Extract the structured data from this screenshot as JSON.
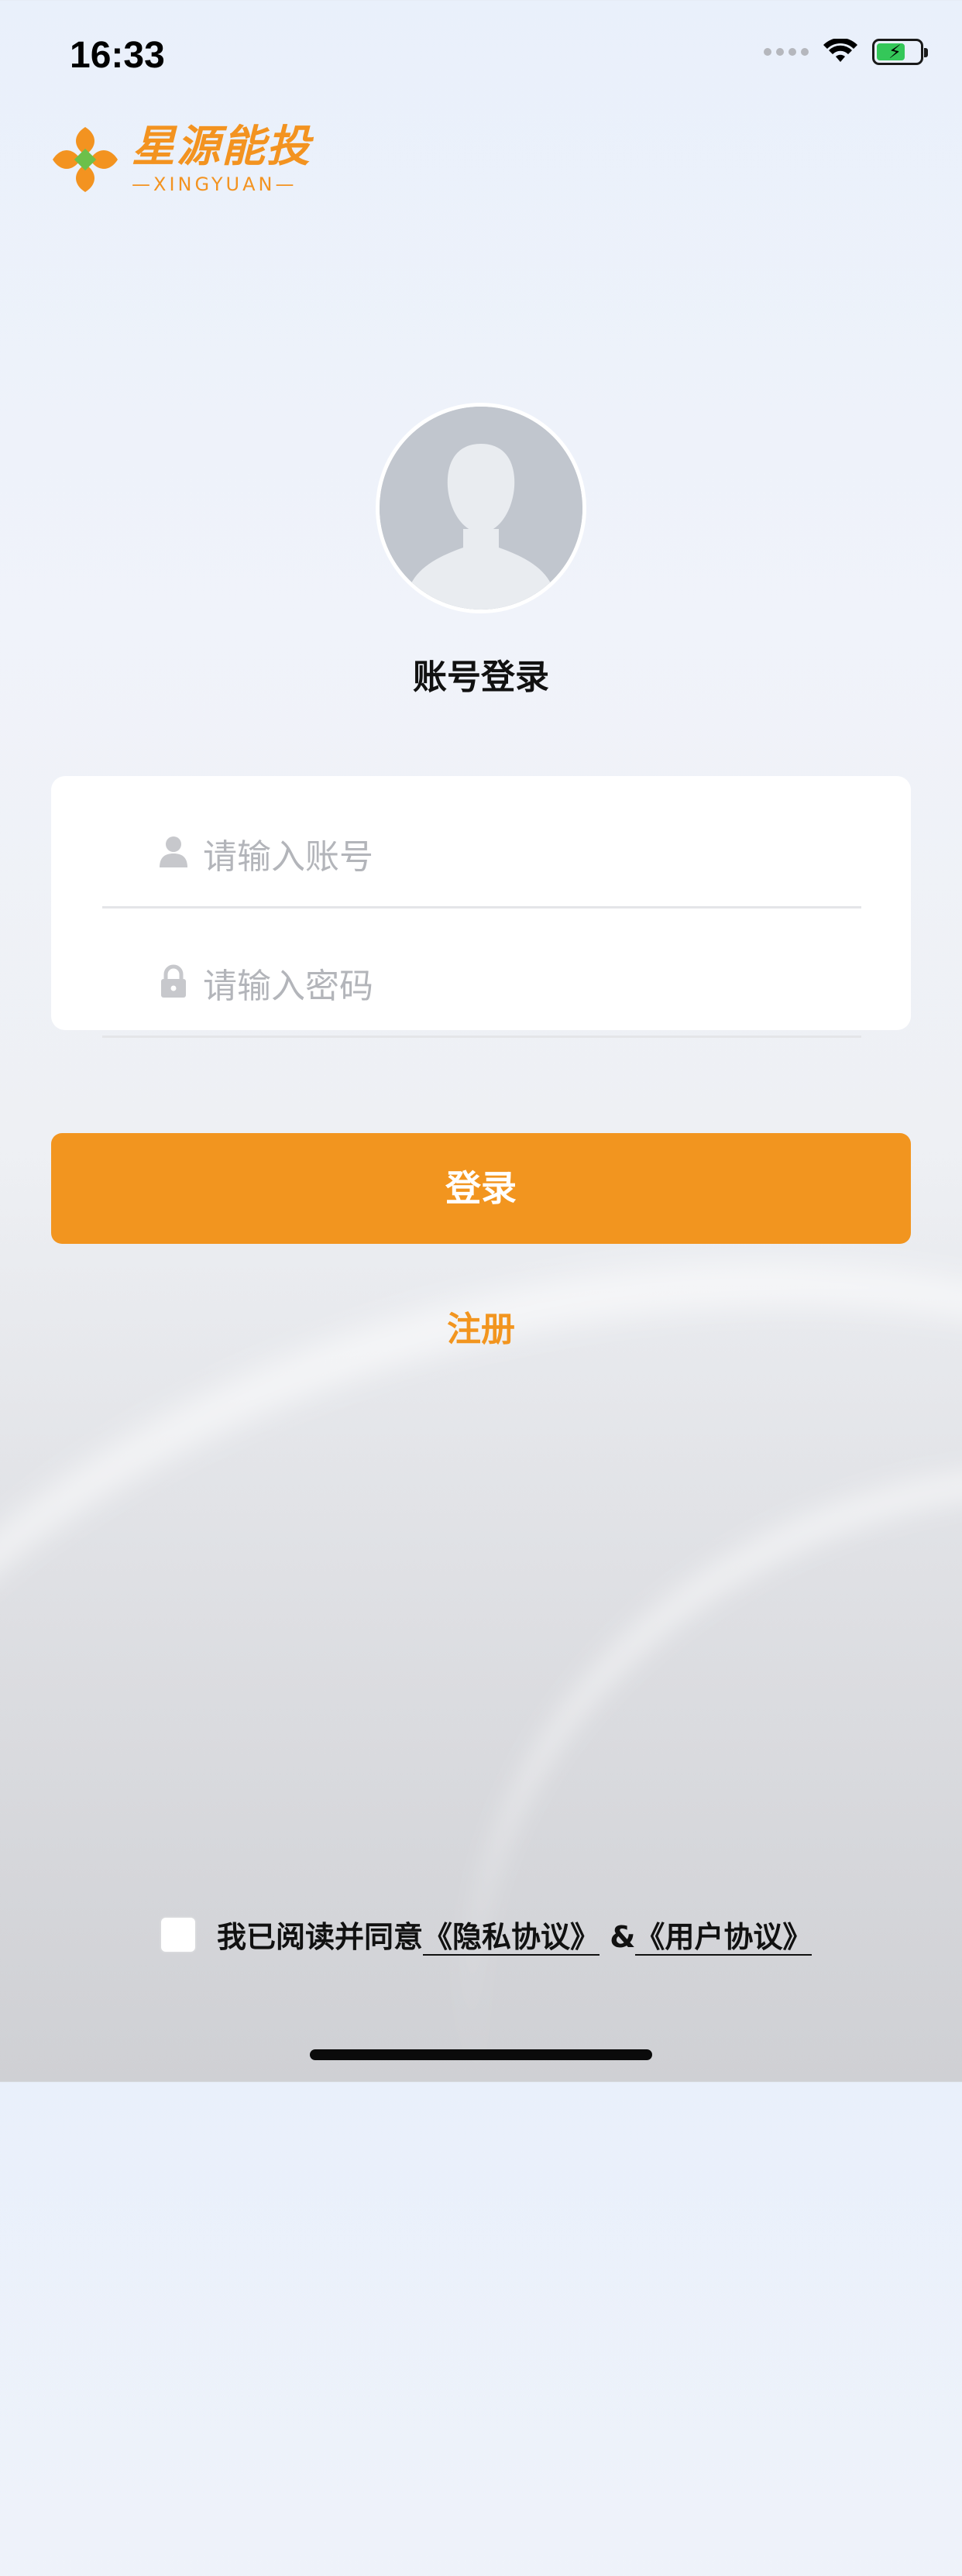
{
  "status_bar": {
    "time": "16:33"
  },
  "logo": {
    "title": "星源能投",
    "subtitle": "—XINGYUAN—"
  },
  "page": {
    "title": "账号登录"
  },
  "form": {
    "account_placeholder": "请输入账号",
    "password_placeholder": "请输入密码"
  },
  "actions": {
    "login_label": "登录",
    "register_label": "注册"
  },
  "agreement": {
    "prefix": "我已阅读并同意",
    "privacy_link": "《隐私协议》",
    "joiner": "&",
    "user_link": "《用户协议》",
    "checked": false
  },
  "colors": {
    "accent": "#f2951f",
    "placeholder": "#b3b5ba"
  }
}
